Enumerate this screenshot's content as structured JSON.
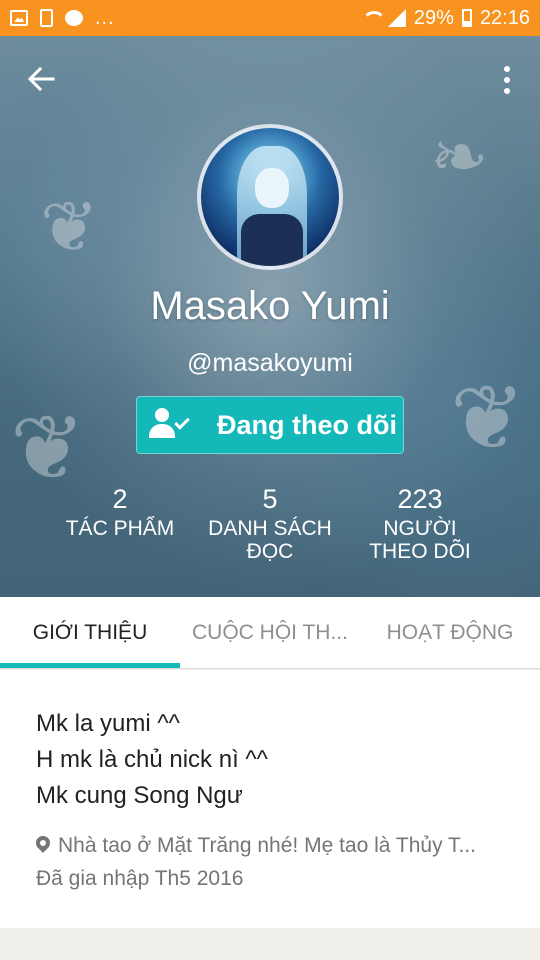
{
  "status_bar": {
    "dots": "...",
    "battery_text": "29%",
    "time": "22:16"
  },
  "profile": {
    "name": "Masako Yumi",
    "handle": "@masakoyumi",
    "follow_label": "Đang theo dõi"
  },
  "stats": [
    {
      "value": "2",
      "label": "TÁC PHẨM"
    },
    {
      "value": "5",
      "label": "DANH SÁCH ĐỌC"
    },
    {
      "value": "223",
      "label": "NGƯỜI THEO DÕI"
    }
  ],
  "tabs": [
    {
      "label": "GIỚI THIỆU",
      "active": true
    },
    {
      "label": "CUỘC HỘI TH...",
      "active": false
    },
    {
      "label": "HOẠT ĐỘNG",
      "active": false
    }
  ],
  "about": {
    "bio": [
      "Mk la yumi ^^",
      "H mk là chủ nick nì ^^",
      "Mk cung Song Ngư"
    ],
    "location": "Nhà tao ở Mặt Trăng nhé! Mẹ tao là Thủy T...",
    "joined": "Đã gia nhập Th5 2016"
  },
  "colors": {
    "status_bar": "#f7931e",
    "accent": "#14b8b8"
  }
}
